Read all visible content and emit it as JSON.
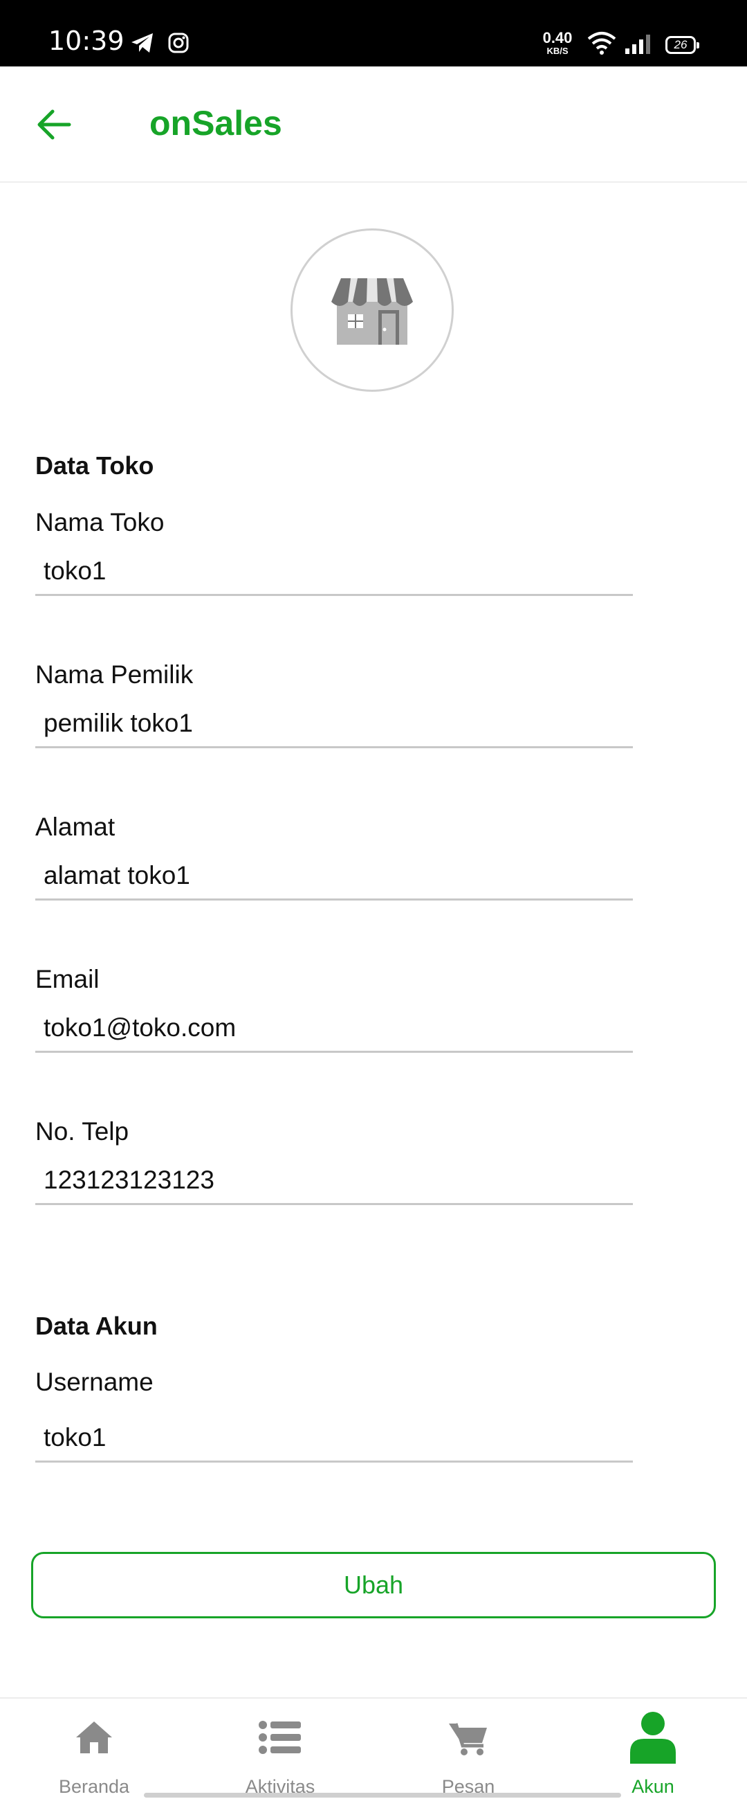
{
  "status_bar": {
    "time": "10:39",
    "net_speed_value": "0.40",
    "net_speed_unit": "KB/S",
    "battery": "26",
    "icons": [
      "telegram-icon",
      "instagram-icon",
      "wifi-icon",
      "signal-icon",
      "battery-icon"
    ]
  },
  "appbar": {
    "title": "onSales",
    "back_icon": "arrow-left-icon",
    "accent_color": "#17a428"
  },
  "store_icon": "storefront-icon",
  "store_section": {
    "title": "Data Toko",
    "fields": [
      {
        "label": "Nama Toko",
        "value": "toko1"
      },
      {
        "label": "Nama Pemilik",
        "value": "pemilik toko1"
      },
      {
        "label": "Alamat",
        "value": "alamat toko1"
      },
      {
        "label": "Email",
        "value": "toko1@toko.com"
      },
      {
        "label": "No. Telp",
        "value": "123123123123"
      }
    ]
  },
  "account_section": {
    "title": "Data Akun",
    "fields": [
      {
        "label": "Username",
        "value": "toko1"
      }
    ]
  },
  "edit_button": {
    "label": "Ubah"
  },
  "bottom_nav": {
    "items": [
      {
        "label": "Beranda",
        "icon": "home-icon",
        "active": false
      },
      {
        "label": "Aktivitas",
        "icon": "list-icon",
        "active": false
      },
      {
        "label": "Pesan",
        "icon": "cart-icon",
        "active": false
      },
      {
        "label": "Akun",
        "icon": "user-icon",
        "active": true
      }
    ]
  }
}
